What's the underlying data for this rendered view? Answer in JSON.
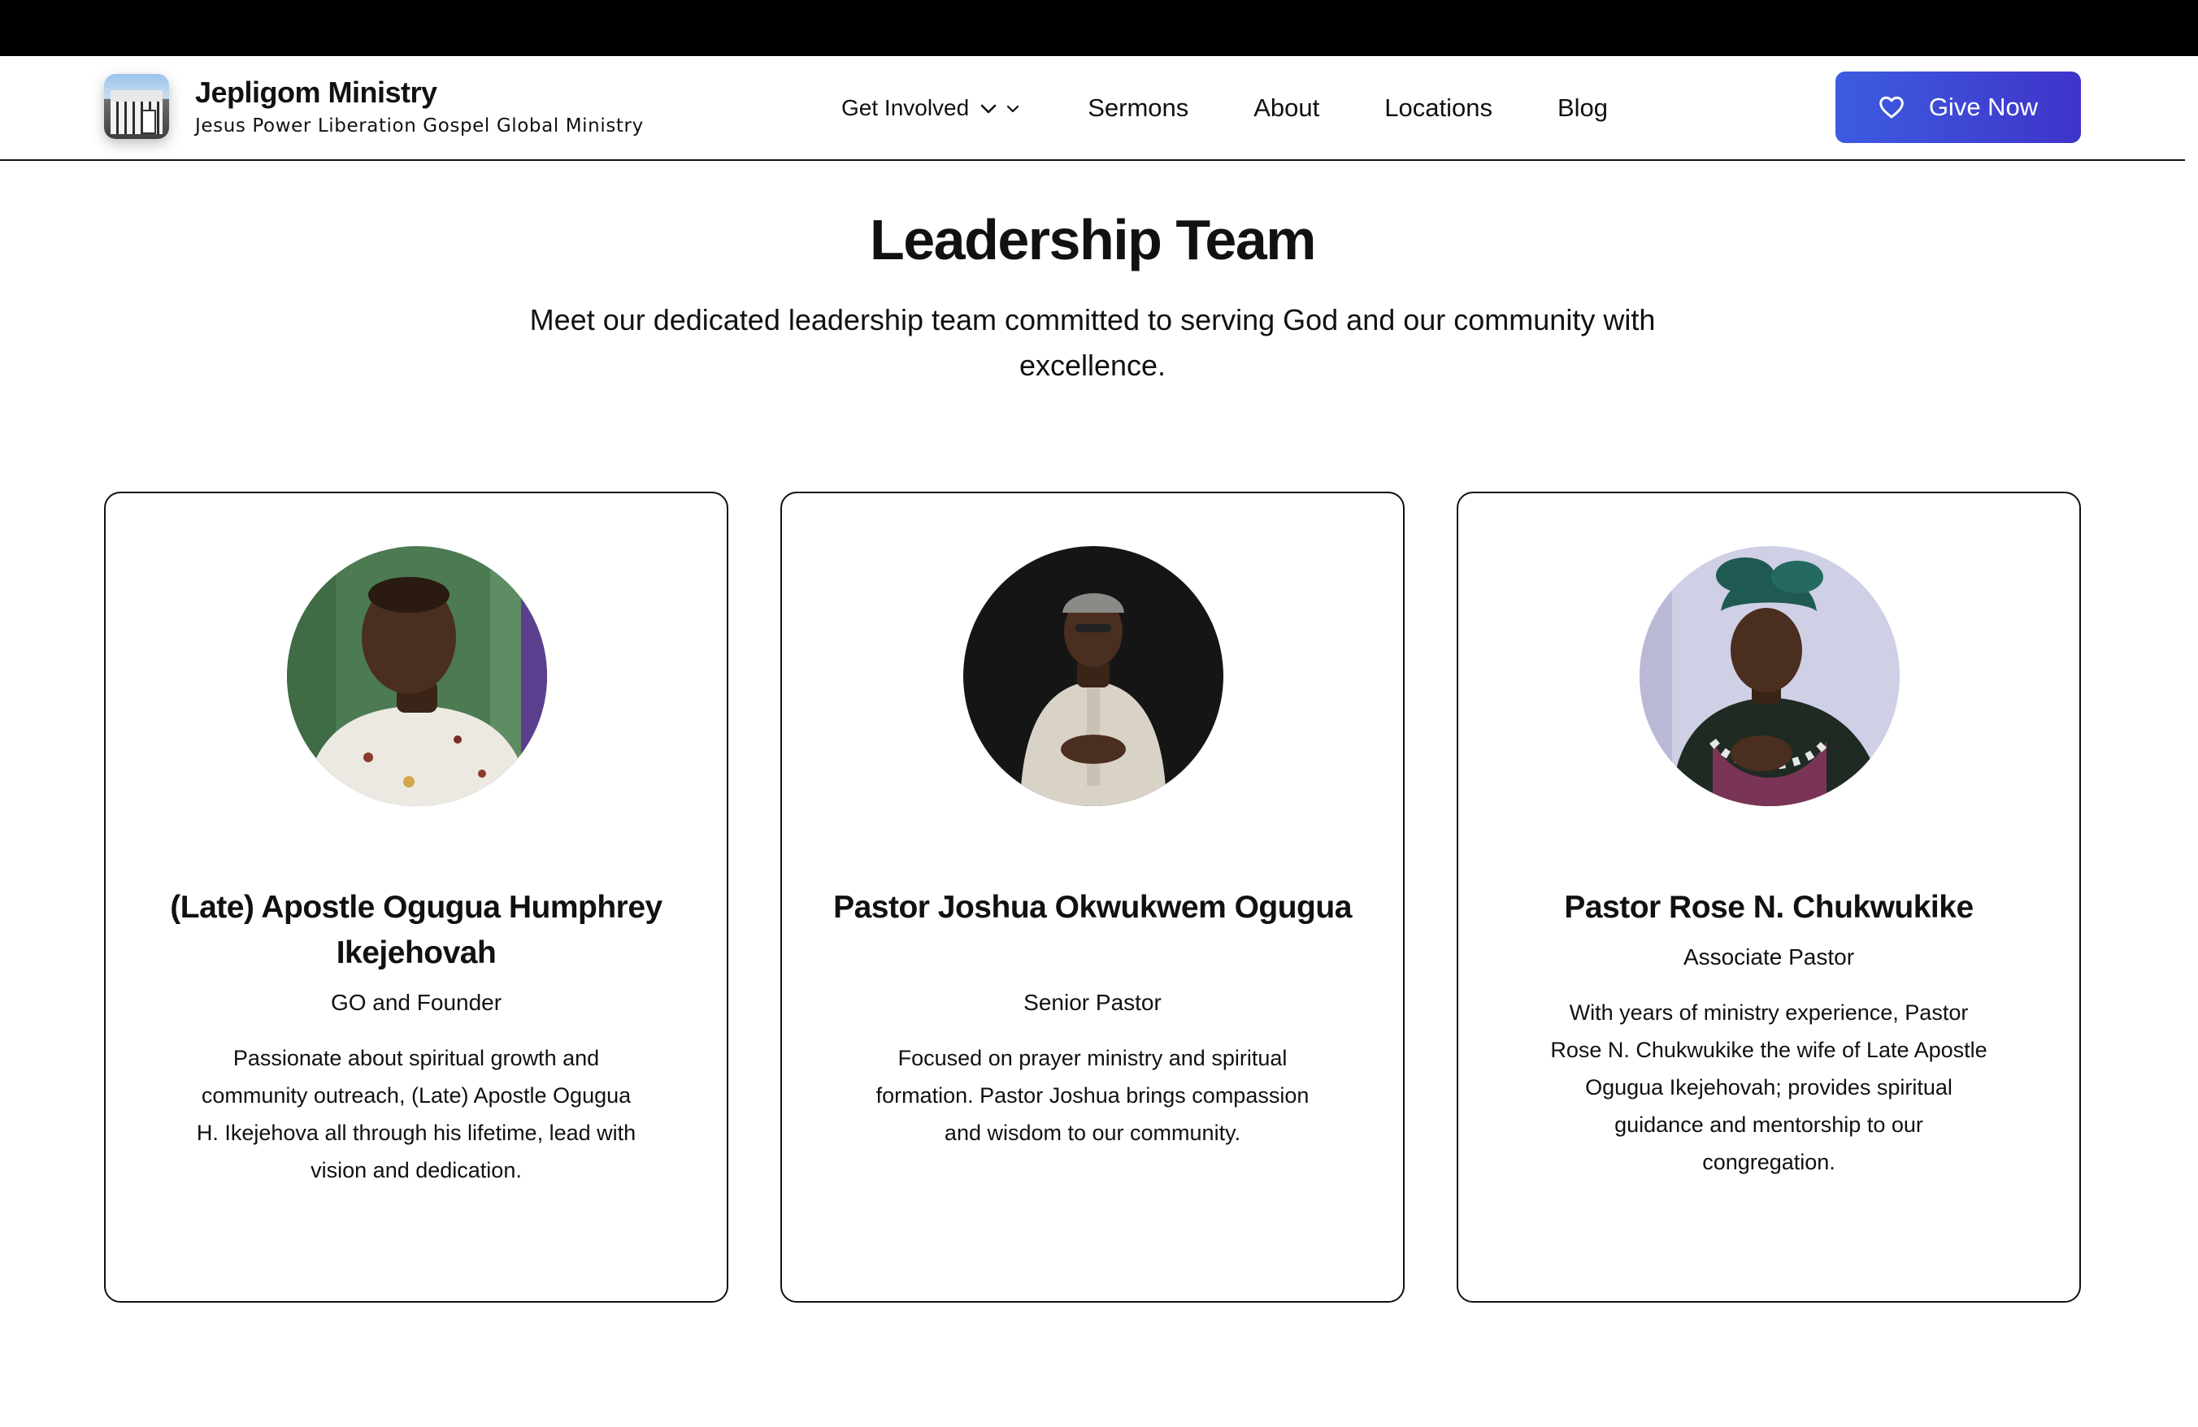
{
  "brand": {
    "name": "Jepligom Ministry",
    "tagline": "Jesus Power Liberation Gospel Global Ministry"
  },
  "nav": {
    "get_involved": "Get Involved",
    "sermons": "Sermons",
    "about": "About",
    "locations": "Locations",
    "blog": "Blog"
  },
  "cta": {
    "give_label": "Give Now"
  },
  "section": {
    "title": "Leadership Team",
    "subtitle": "Meet our dedicated leadership team committed to serving God and our community with excellence."
  },
  "leaders": [
    {
      "name": "(Late) Apostle Ogugua Humphrey Ikejehovah",
      "role": "GO and Founder",
      "description": "Passionate about spiritual growth and community outreach, (Late) Apostle Ogugua H. Ikejehova all through his lifetime, lead with vision and dedication."
    },
    {
      "name": "Pastor Joshua Okwukwem Ogugua",
      "role": "Senior Pastor",
      "description": "Focused on prayer ministry and spiritual formation. Pastor Joshua brings compassion and wisdom to our community."
    },
    {
      "name": "Pastor Rose N. Chukwukike",
      "role": "Associate Pastor",
      "description": "With years of ministry experience, Pastor Rose N. Chukwukike the wife of Late Apostle Ogugua Ikejehovah; provides spiritual guidance and mentorship to our congregation."
    }
  ],
  "colors": {
    "accent": "#3d5ce0",
    "accent_end": "#3e34c9",
    "text": "#111111",
    "top_strip": "#000000"
  },
  "icons": {
    "dropdown": "chevron-down-icon",
    "give": "heart-icon"
  }
}
